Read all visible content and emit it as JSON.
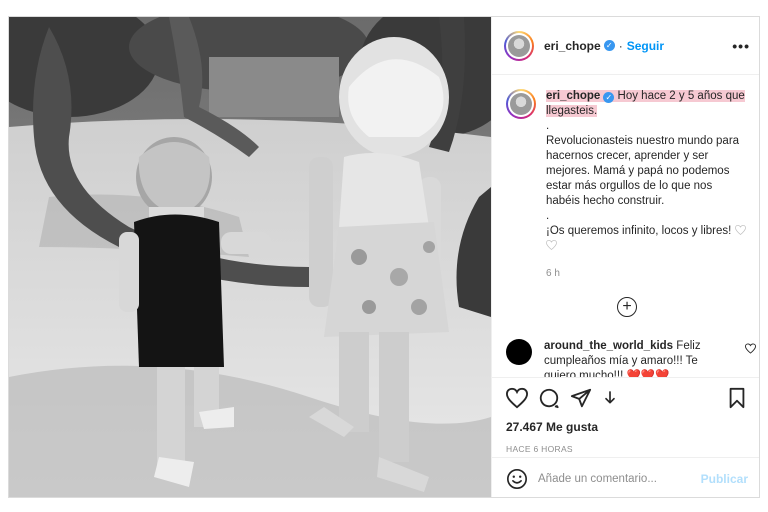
{
  "post": {
    "username": "eri_chope",
    "follow_label": "Seguir",
    "more_label": "•••",
    "caption": {
      "username": "eri_chope",
      "highlight_text": "Hoy hace 2 y 5 años que llegasteis.",
      "lines": [
        ".",
        "Revolucionasteis nuestro mundo para hacernos crecer, aprender y ser mejores. Mamá y papá no podemos estar más orgullos de lo que nos habéis hecho construir.",
        ".",
        "¡Os queremos infinito, locos y libres!"
      ],
      "time": "6 h"
    },
    "load_more_label": "+",
    "comments": [
      {
        "username": "around_the_world_kids",
        "text": "Feliz cumpleaños mía y amaro!!! Te quiero mucho!!! ❤️❤️❤️"
      }
    ],
    "likes": "27.467 Me gusta",
    "post_time": "HACE 6 HORAS",
    "add_comment_placeholder": "Añade un comentario...",
    "publish_label": "Publicar"
  },
  "icons": {
    "like": "heart-icon",
    "comment": "comment-icon",
    "share": "share-icon",
    "save": "bookmark-icon",
    "emoji": "emoji-icon",
    "download": "download-arrow-icon"
  },
  "colors": {
    "accent": "#0095f6",
    "verified": "#3897f0",
    "highlight": "#f6c9d2",
    "muted": "#8e8e8e",
    "publish_disabled": "#b2dffc"
  }
}
